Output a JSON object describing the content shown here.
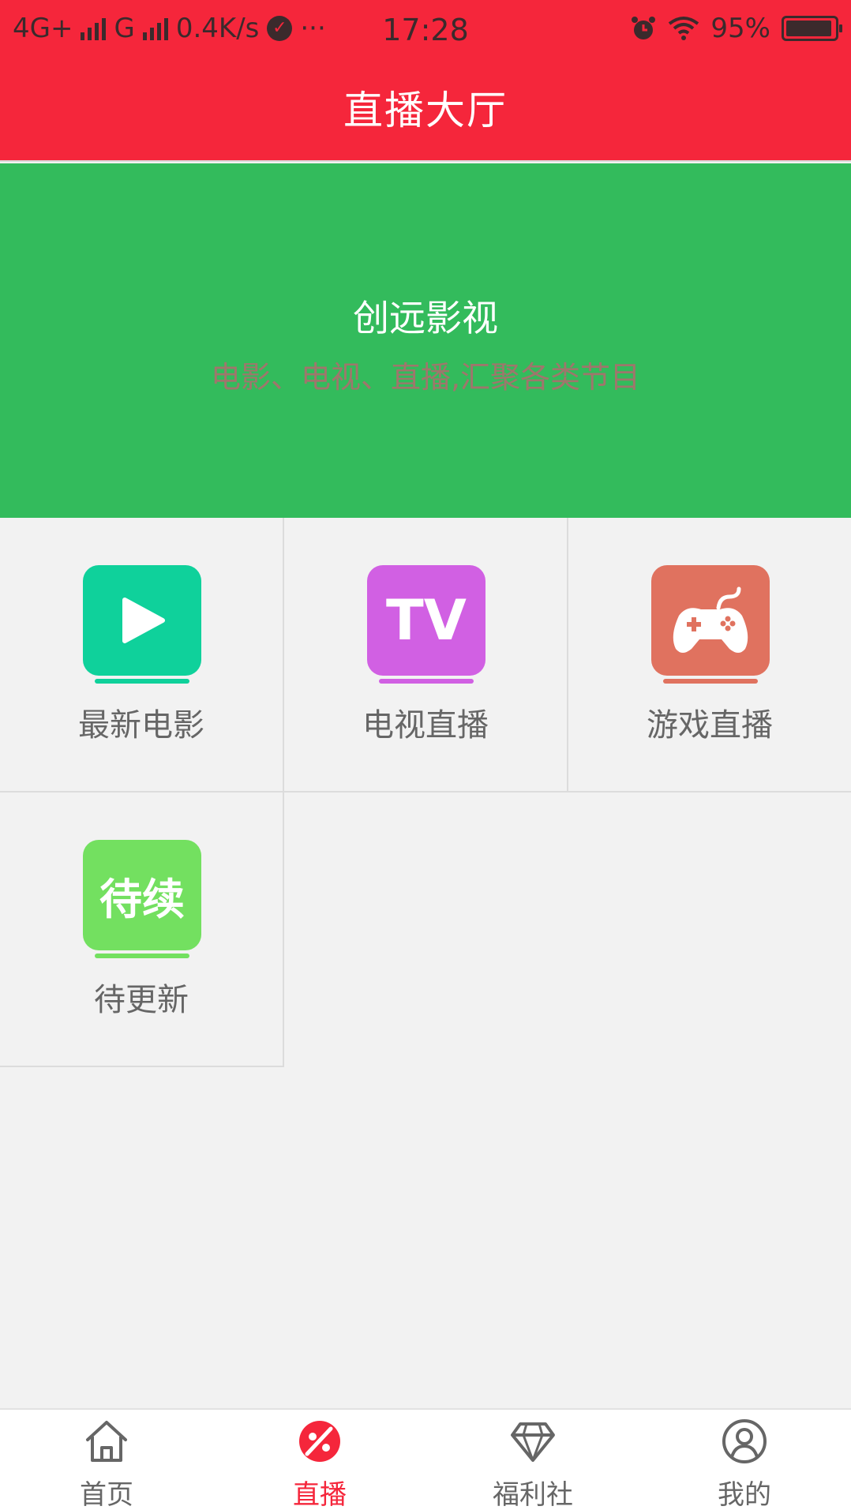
{
  "status_bar": {
    "network1": "4G+",
    "network2": "G",
    "speed": "0.4K/s",
    "more": "···",
    "time": "17:28",
    "battery": "95%"
  },
  "header": {
    "title": "直播大厅"
  },
  "banner": {
    "title": "创远影视",
    "subtitle": "电影、电视、直播,汇聚各类节目"
  },
  "grid": [
    {
      "label": "最新电影",
      "icon": "play-icon",
      "color": "#0fd19b"
    },
    {
      "label": "电视直播",
      "icon": "tv-icon",
      "icon_text": "TV",
      "color": "#d160e3"
    },
    {
      "label": "游戏直播",
      "icon": "gamepad-icon",
      "color": "#e0725f"
    },
    {
      "label": "待更新",
      "icon": "pending-icon",
      "icon_text": "待续",
      "color": "#73e060"
    }
  ],
  "bottom_nav": {
    "items": [
      {
        "label": "首页",
        "icon": "home-icon",
        "active": false
      },
      {
        "label": "直播",
        "icon": "live-icon",
        "active": true
      },
      {
        "label": "福利社",
        "icon": "diamond-icon",
        "active": false
      },
      {
        "label": "我的",
        "icon": "user-icon",
        "active": false
      }
    ]
  },
  "colors": {
    "header_bg": "#f5263b",
    "banner_bg": "#33bb5c",
    "active_tab": "#f5263b"
  }
}
